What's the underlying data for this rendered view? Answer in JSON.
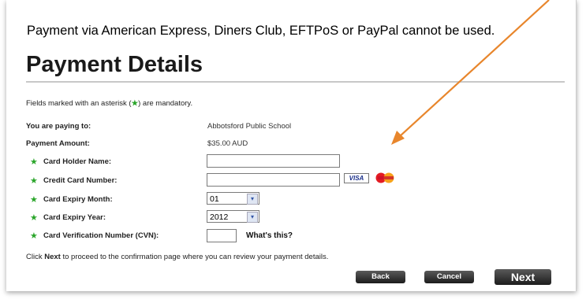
{
  "notice": "Payment via American Express, Diners Club, EFTPoS or PayPal cannot be used.",
  "title": "Payment Details",
  "mandatory": {
    "before": "Fields marked with an asterisk (",
    "star": "★",
    "after": ") are mandatory."
  },
  "paying_to": {
    "label": "You are paying to:",
    "value": "Abbotsford Public School"
  },
  "amount": {
    "label": "Payment Amount:",
    "value": "$35.00  AUD"
  },
  "fields": {
    "card_holder_label": "Card Holder Name:",
    "card_number_label": "Credit Card Number:",
    "expiry_month_label": "Card Expiry Month:",
    "expiry_month_value": "01",
    "expiry_year_label": "Card Expiry Year:",
    "expiry_year_value": "2012",
    "cvn_label": "Card Verification Number (CVN):",
    "whats_this": "What's this?"
  },
  "star_glyph": "★",
  "chevron_glyph": "▾",
  "card_logos": {
    "visa": "VISA",
    "mastercard": "MasterCard"
  },
  "instruction": {
    "before": "Click ",
    "bold": "Next",
    "after": " to proceed to the confirmation page where you can review your payment details."
  },
  "buttons": {
    "back": "Back",
    "cancel": "Cancel",
    "next": "Next"
  },
  "colors": {
    "star": "#2aa52a",
    "arrow": "#e8862c",
    "button": "#2b2b2b"
  },
  "annotation": {
    "type": "arrow-icon",
    "color": "#e8862c"
  }
}
